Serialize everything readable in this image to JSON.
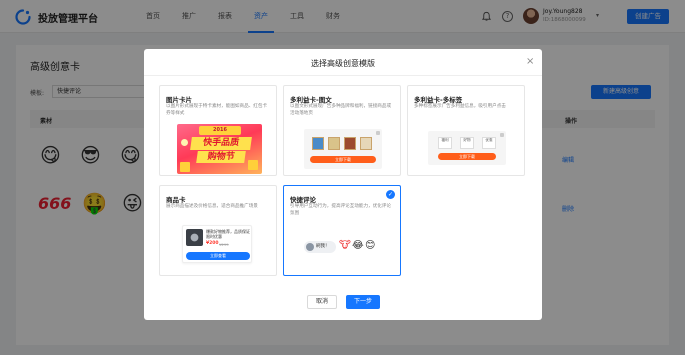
{
  "header": {
    "app_title": "投放管理平台",
    "nav": [
      {
        "label": "首页",
        "active": false
      },
      {
        "label": "推广",
        "active": false
      },
      {
        "label": "报表",
        "active": false
      },
      {
        "label": "资产",
        "active": true
      },
      {
        "label": "工具",
        "active": false
      },
      {
        "label": "财务",
        "active": false
      }
    ],
    "user_name": "Joy.Young828",
    "user_id": "ID:1868000099",
    "help_glyph": "?",
    "create_button": "创建广告",
    "accent_color": "#1677ff"
  },
  "page": {
    "title": "高级创意卡",
    "filter_label": "模板:",
    "filter_value": "快捷评论",
    "new_button": "新建高级创意",
    "col_material": "素材",
    "col_operation": "操作",
    "rows": [
      {
        "emojis": [
          "😋",
          "😎",
          "😋"
        ],
        "op": "编辑"
      },
      {
        "emojis": [
          "666",
          "🤑",
          "😜"
        ],
        "op": "删除"
      }
    ]
  },
  "modal": {
    "title": "选择高级创意模版",
    "close_glyph": "×",
    "templates": [
      {
        "title": "图片卡片",
        "desc": "以图片形式展现于特卡素材，能图如商品、红包卡券等样式",
        "selected": false
      },
      {
        "title": "多利益卡-图文",
        "desc": "以图文形式展现广告多种品牌和福利，链接商品或活动落地页",
        "selected": false
      },
      {
        "title": "多利益卡-多标签",
        "desc": "多种标签展示广告多利益信息，吸引用户点击",
        "selected": false
      },
      {
        "title": "商品卡",
        "desc": "展示商品描述及价格信息，适合商品推广场景",
        "selected": false
      },
      {
        "title": "快捷评论",
        "desc": "引导用户互动行为，提高评论互动能力，优化评论氛围",
        "selected": true
      }
    ],
    "previews": {
      "banner_tag": "2016",
      "banner_line1": "快手品质",
      "banner_line2": "购物节",
      "multi_benefit_button": "立即下载",
      "multi_tag_items": [
        "福利",
        "好物",
        "优惠"
      ],
      "multi_tag_button": "立即下载",
      "product_name": "爆款好物推荐，品质保证限时优惠",
      "product_price": "¥200",
      "product_old_price": "¥299",
      "product_button": "立即查看",
      "comment_text": "刷我！"
    },
    "cancel_label": "取消",
    "next_label": "下一步"
  }
}
